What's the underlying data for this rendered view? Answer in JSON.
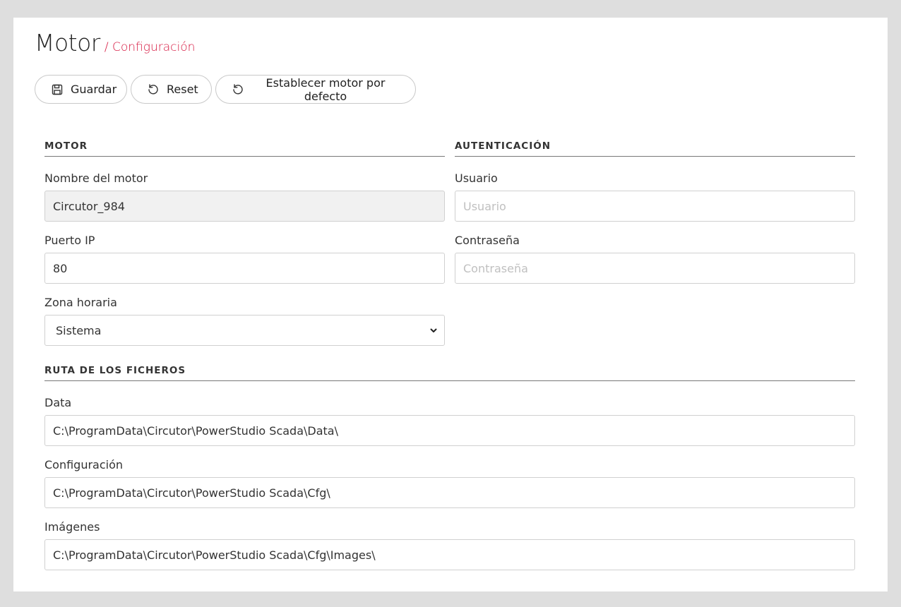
{
  "header": {
    "title": "Motor",
    "subtitle": "/ Configuración"
  },
  "toolbar": {
    "save_label": "Guardar",
    "reset_label": "Reset",
    "default_label": "Establecer motor por defecto"
  },
  "motor": {
    "heading": "MOTOR",
    "name_label": "Nombre del motor",
    "name_value": "Circutor_984",
    "port_label": "Puerto IP",
    "port_value": "80",
    "tz_label": "Zona horaria",
    "tz_value": "Sistema"
  },
  "auth": {
    "heading": "AUTENTICACIÓN",
    "user_label": "Usuario",
    "user_placeholder": "Usuario",
    "pass_label": "Contraseña",
    "pass_placeholder": "Contraseña"
  },
  "paths": {
    "heading": "RUTA DE LOS FICHEROS",
    "data_label": "Data",
    "data_value": "C:\\ProgramData\\Circutor\\PowerStudio Scada\\Data\\",
    "cfg_label": "Configuración",
    "cfg_value": "C:\\ProgramData\\Circutor\\PowerStudio Scada\\Cfg\\",
    "img_label": "Imágenes",
    "img_value": "C:\\ProgramData\\Circutor\\PowerStudio Scada\\Cfg\\Images\\"
  }
}
